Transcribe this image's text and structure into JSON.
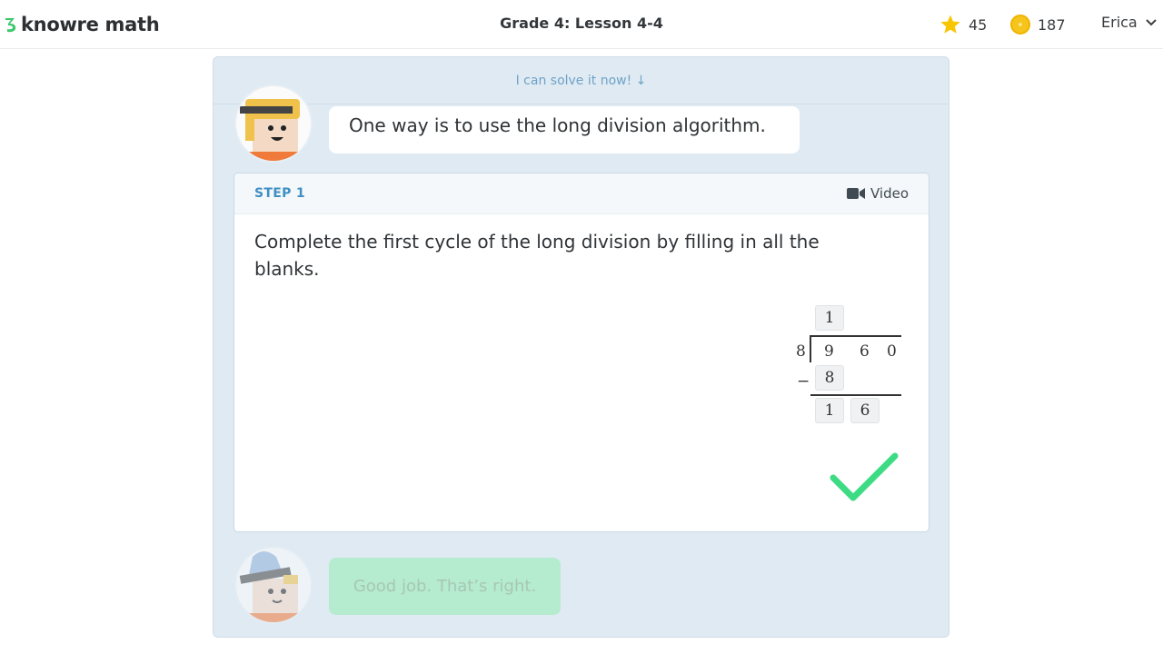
{
  "header": {
    "logo_text": "knowre math",
    "lesson_title": "Grade 4: Lesson 4-4",
    "stars": "45",
    "coins": "187",
    "user_name": "Erica"
  },
  "panel": {
    "solve_prompt": "I can solve it now! ↓",
    "tutor_message": "One way is to use the long division algorithm.",
    "feedback_message": "Good job. That’s right."
  },
  "step": {
    "label": "STEP 1",
    "video_label": "Video",
    "instruction": "Complete the first cycle of the long division by filling in all the blanks."
  },
  "division": {
    "divisor": "8",
    "dividend_digits": [
      "9",
      "6",
      "0"
    ],
    "quotient_entry": "1",
    "minus_sign": "−",
    "subtract_entry": "8",
    "remainder_entries": [
      "1",
      "6"
    ]
  },
  "colors": {
    "accent": "#3e8fc4",
    "panel_bg": "#dfeaf3",
    "success": "#3ddc84",
    "star": "#f7c600",
    "coin": "#f6c51b"
  },
  "icons": [
    "logo-mark-icon",
    "star-icon",
    "coin-icon",
    "chevron-down-icon",
    "video-camera-icon",
    "checkmark-icon",
    "tutor-avatar-icon"
  ]
}
